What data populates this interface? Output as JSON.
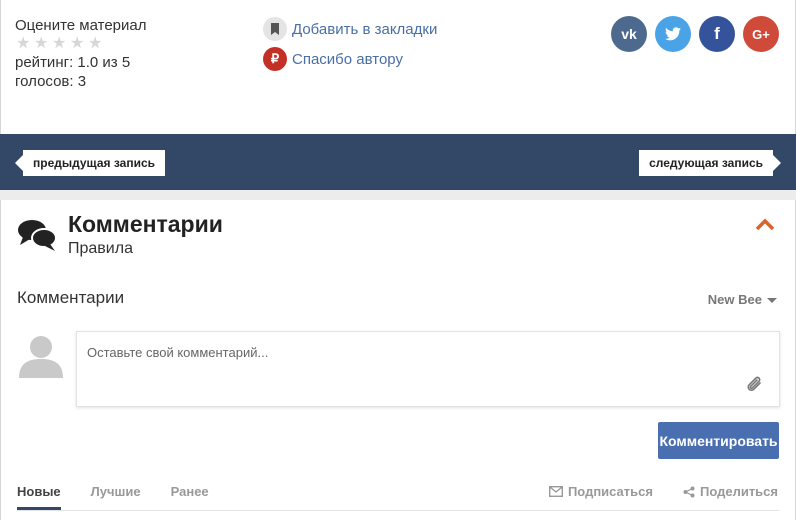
{
  "rating": {
    "title": "Оцените материал",
    "score_text": "рейтинг: 1.0 из 5",
    "votes_text": "голосов: 3",
    "stars": 0
  },
  "actions": {
    "bookmark": "Добавить в закладки",
    "thanks": "Спасибо автору"
  },
  "socials": [
    {
      "icon": "vk-icon",
      "glyph": "vk",
      "color": "#4d6a8e"
    },
    {
      "icon": "twitter-icon",
      "glyph": "t",
      "color": "#4aa3e6"
    },
    {
      "icon": "facebook-icon",
      "glyph": "f",
      "color": "#34539a"
    },
    {
      "icon": "google-plus-icon",
      "glyph": "G+",
      "color": "#d04a3a"
    }
  ],
  "nav": {
    "prev": "предыдущая запись",
    "next": "следующая запись"
  },
  "comments_section": {
    "title": "Комментарии",
    "rules": "Правила",
    "list_title": "Комментарии",
    "sort_selected": "New Bee",
    "input_placeholder": "Оставьте свой комментарий...",
    "submit": "Комментировать"
  },
  "tabs": [
    {
      "label": "Новые",
      "active": true
    },
    {
      "label": "Лучшие",
      "active": false
    },
    {
      "label": "Ранее",
      "active": false
    }
  ],
  "tab_actions": {
    "subscribe": "Подписаться",
    "share": "Поделиться"
  },
  "colors": {
    "band": "#334767",
    "accent_link": "#4a6fa5",
    "button": "#4a6fb0",
    "collapse_chevron": "#d8652a"
  }
}
